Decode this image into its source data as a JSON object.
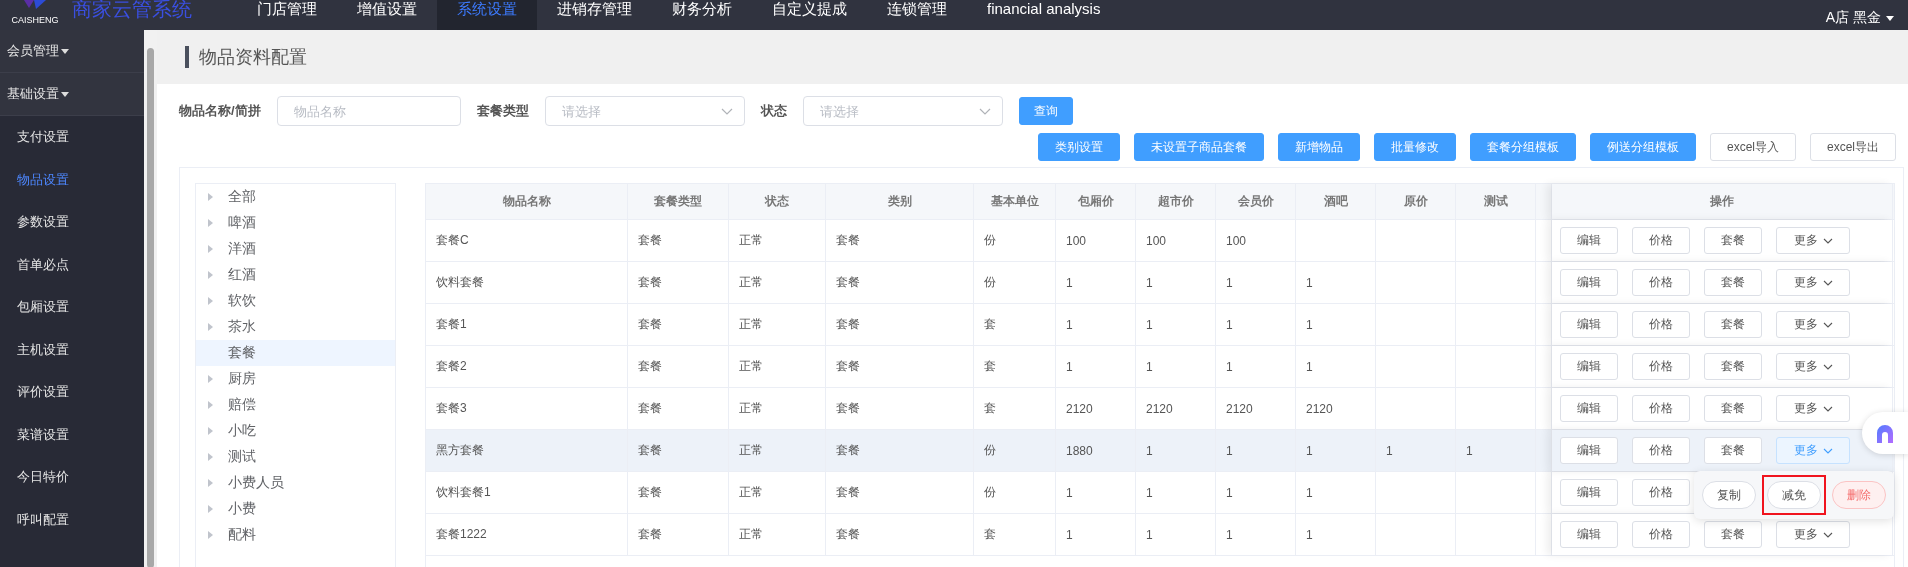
{
  "app": {
    "logo_text": "CAISHENG",
    "title": "商家云管系统"
  },
  "nav": [
    {
      "label": "门店管理",
      "selected": false
    },
    {
      "label": "增值设置",
      "selected": false
    },
    {
      "label": "系统设置",
      "selected": true
    },
    {
      "label": "进销存管理",
      "selected": false
    },
    {
      "label": "财务分析",
      "selected": false
    },
    {
      "label": "自定义提成",
      "selected": false
    },
    {
      "label": "连锁管理",
      "selected": false
    },
    {
      "label": "financial analysis",
      "selected": false
    }
  ],
  "user": {
    "label": "A店 黑金"
  },
  "sidebar": {
    "groups": [
      {
        "label": "会员管理",
        "expanded": true
      },
      {
        "label": "基础设置",
        "expanded": true
      }
    ],
    "items": [
      {
        "label": "支付设置",
        "selected": false
      },
      {
        "label": "物品设置",
        "selected": true
      },
      {
        "label": "参数设置",
        "selected": false
      },
      {
        "label": "首单必点",
        "selected": false
      },
      {
        "label": "包厢设置",
        "selected": false
      },
      {
        "label": "主机设置",
        "selected": false
      },
      {
        "label": "评价设置",
        "selected": false
      },
      {
        "label": "菜谱设置",
        "selected": false
      },
      {
        "label": "今日特价",
        "selected": false
      },
      {
        "label": "呼叫配置",
        "selected": false
      }
    ]
  },
  "page_title": "物品资料配置",
  "filters": [
    {
      "kind": "text",
      "label": "物品名称/简拼",
      "placeholder": "物品名称"
    },
    {
      "kind": "select",
      "label": "套餐类型",
      "placeholder": "请选择"
    },
    {
      "kind": "select",
      "label": "状态",
      "placeholder": "请选择"
    }
  ],
  "query_button": "查询",
  "toolbar": [
    {
      "label": "类别设置",
      "kind": "primary"
    },
    {
      "label": "未设置子商品套餐",
      "kind": "primary"
    },
    {
      "label": "新增物品",
      "kind": "primary"
    },
    {
      "label": "批量修改",
      "kind": "primary"
    },
    {
      "label": "套餐分组模板",
      "kind": "primary"
    },
    {
      "label": "例送分组模板",
      "kind": "primary"
    },
    {
      "label": "excel导入",
      "kind": "default"
    },
    {
      "label": "excel导出",
      "kind": "default"
    }
  ],
  "tree": [
    {
      "label": "全部",
      "has_children": true,
      "selected": false
    },
    {
      "label": "啤酒",
      "has_children": true,
      "selected": false
    },
    {
      "label": "洋酒",
      "has_children": true,
      "selected": false
    },
    {
      "label": "红酒",
      "has_children": true,
      "selected": false
    },
    {
      "label": "软饮",
      "has_children": true,
      "selected": false
    },
    {
      "label": "茶水",
      "has_children": true,
      "selected": false
    },
    {
      "label": "套餐",
      "has_children": false,
      "selected": true
    },
    {
      "label": "厨房",
      "has_children": true,
      "selected": false
    },
    {
      "label": "赔偿",
      "has_children": true,
      "selected": false
    },
    {
      "label": "小吃",
      "has_children": true,
      "selected": false
    },
    {
      "label": "测试",
      "has_children": true,
      "selected": false
    },
    {
      "label": "小费人员",
      "has_children": true,
      "selected": false
    },
    {
      "label": "小费",
      "has_children": true,
      "selected": false
    },
    {
      "label": "配料",
      "has_children": true,
      "selected": false
    }
  ],
  "table": {
    "columns": [
      "物品名称",
      "套餐类型",
      "状态",
      "类别",
      "基本单位",
      "包厢价",
      "超市价",
      "会员价",
      "酒吧",
      "原价",
      "测试"
    ],
    "actions_column": "操作",
    "rows": [
      {
        "cells": [
          "套餐C",
          "套餐",
          "正常",
          "套餐",
          "份",
          "100",
          "100",
          "100",
          "",
          "",
          ""
        ],
        "hover": false,
        "actions": [
          {
            "label": "编辑",
            "kind": "plain"
          },
          {
            "label": "价格",
            "kind": "plain"
          },
          {
            "label": "套餐",
            "kind": "plain"
          },
          {
            "label": "更多",
            "kind": "more",
            "open": false
          }
        ]
      },
      {
        "cells": [
          "饮料套餐",
          "套餐",
          "正常",
          "套餐",
          "份",
          "1",
          "1",
          "1",
          "1",
          "",
          ""
        ],
        "hover": false,
        "actions": [
          {
            "label": "编辑",
            "kind": "plain"
          },
          {
            "label": "价格",
            "kind": "plain"
          },
          {
            "label": "套餐",
            "kind": "plain"
          },
          {
            "label": "更多",
            "kind": "more",
            "open": false
          }
        ]
      },
      {
        "cells": [
          "套餐1",
          "套餐",
          "正常",
          "套餐",
          "套",
          "1",
          "1",
          "1",
          "1",
          "",
          ""
        ],
        "hover": false,
        "actions": [
          {
            "label": "编辑",
            "kind": "plain"
          },
          {
            "label": "价格",
            "kind": "plain"
          },
          {
            "label": "套餐",
            "kind": "plain"
          },
          {
            "label": "更多",
            "kind": "more",
            "open": false
          }
        ]
      },
      {
        "cells": [
          "套餐2",
          "套餐",
          "正常",
          "套餐",
          "套",
          "1",
          "1",
          "1",
          "1",
          "",
          ""
        ],
        "hover": false,
        "actions": [
          {
            "label": "编辑",
            "kind": "plain"
          },
          {
            "label": "价格",
            "kind": "plain"
          },
          {
            "label": "套餐",
            "kind": "plain"
          },
          {
            "label": "更多",
            "kind": "more",
            "open": false
          }
        ]
      },
      {
        "cells": [
          "套餐3",
          "套餐",
          "正常",
          "套餐",
          "套",
          "2120",
          "2120",
          "2120",
          "2120",
          "",
          ""
        ],
        "hover": false,
        "actions": [
          {
            "label": "编辑",
            "kind": "plain"
          },
          {
            "label": "价格",
            "kind": "plain"
          },
          {
            "label": "套餐",
            "kind": "plain"
          },
          {
            "label": "更多",
            "kind": "more",
            "open": false
          }
        ]
      },
      {
        "cells": [
          "黑方套餐",
          "套餐",
          "正常",
          "套餐",
          "份",
          "1880",
          "1",
          "1",
          "1",
          "1",
          "1"
        ],
        "hover": true,
        "actions": [
          {
            "label": "编辑",
            "kind": "plain"
          },
          {
            "label": "价格",
            "kind": "plain"
          },
          {
            "label": "套餐",
            "kind": "plain"
          },
          {
            "label": "更多",
            "kind": "more",
            "open": true
          }
        ]
      },
      {
        "cells": [
          "饮料套餐1",
          "套餐",
          "正常",
          "套餐",
          "份",
          "1",
          "1",
          "1",
          "1",
          "",
          ""
        ],
        "hover": false,
        "actions": [
          {
            "label": "编辑",
            "kind": "plain"
          },
          {
            "label": "价格",
            "kind": "plain"
          }
        ]
      },
      {
        "cells": [
          "套餐1222",
          "套餐",
          "正常",
          "套餐",
          "套",
          "1",
          "1",
          "1",
          "1",
          "",
          ""
        ],
        "hover": false,
        "actions": [
          {
            "label": "编辑",
            "kind": "plain"
          },
          {
            "label": "价格",
            "kind": "plain"
          },
          {
            "label": "套餐",
            "kind": "plain"
          },
          {
            "label": "更多",
            "kind": "more",
            "open": false
          }
        ]
      }
    ]
  },
  "more_menu": [
    {
      "label": "复制",
      "kind": "default",
      "highlighted": false
    },
    {
      "label": "减免",
      "kind": "default",
      "highlighted": true
    },
    {
      "label": "删除",
      "kind": "danger",
      "highlighted": false
    }
  ]
}
